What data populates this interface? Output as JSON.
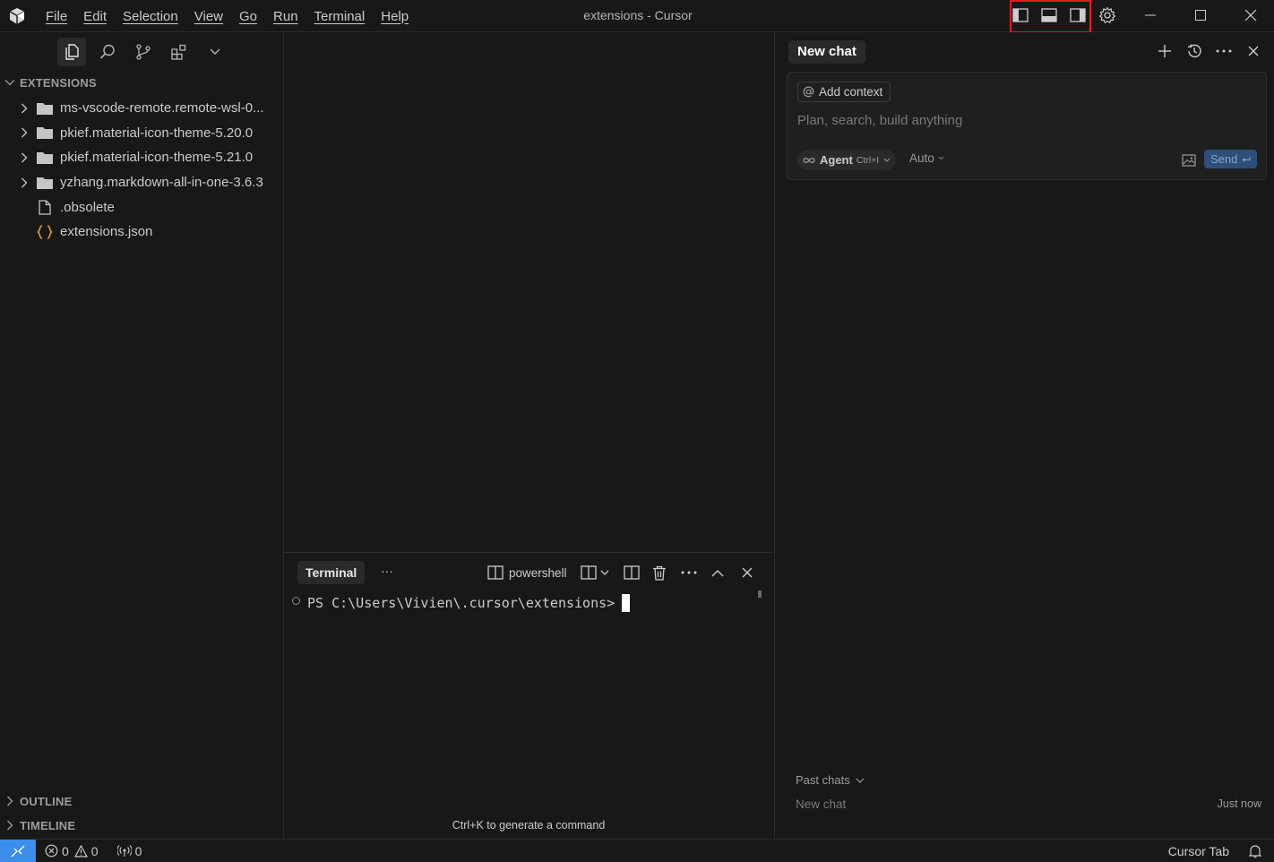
{
  "window": {
    "title": "extensions - Cursor"
  },
  "menu": [
    "File",
    "Edit",
    "Selection",
    "View",
    "Go",
    "Run",
    "Terminal",
    "Help"
  ],
  "explorer": {
    "section": "EXTENSIONS",
    "items": [
      {
        "type": "folder",
        "label": "ms-vscode-remote.remote-wsl-0..."
      },
      {
        "type": "folder",
        "label": "pkief.material-icon-theme-5.20.0"
      },
      {
        "type": "folder",
        "label": "pkief.material-icon-theme-5.21.0"
      },
      {
        "type": "folder",
        "label": "yzhang.markdown-all-in-one-3.6.3"
      },
      {
        "type": "file",
        "label": ".obsolete"
      },
      {
        "type": "json",
        "label": "extensions.json"
      }
    ],
    "outline": "OUTLINE",
    "timeline": "TIMELINE"
  },
  "panel": {
    "tab": "Terminal",
    "more": "···",
    "shell": "powershell",
    "prompt": "PS C:\\Users\\Vivien\\.cursor\\extensions>",
    "hint": "Ctrl+K to generate a command"
  },
  "chat": {
    "tab": "New chat",
    "add_context": "Add context",
    "placeholder": "Plan, search, build anything",
    "agent_label": "Agent",
    "agent_shortcut": "Ctrl+I",
    "model": "Auto",
    "send": "Send",
    "past_chats": "Past chats",
    "history": [
      {
        "title": "New chat",
        "time": "Just now"
      }
    ]
  },
  "status": {
    "errors": "0",
    "warnings": "0",
    "ports": "0",
    "cursor_tab": "Cursor Tab"
  },
  "colors": {
    "background": "#181818",
    "accent": "#3b8eea",
    "highlight_box": "#e01b24",
    "json_icon": "#e5a430"
  }
}
